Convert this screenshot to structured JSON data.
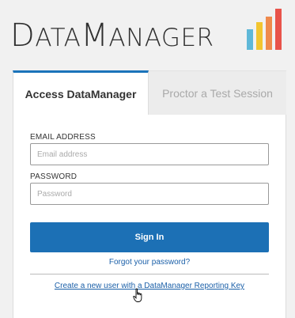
{
  "logo": {
    "prefix_d": "D",
    "ata": "ATA",
    "m": "M",
    "anager": "ANAGER"
  },
  "logo_colors": [
    "#5fb8d8",
    "#f2c530",
    "#ef8a4c",
    "#e8534a"
  ],
  "tabs": [
    {
      "label": "Access DataManager",
      "active": true
    },
    {
      "label": "Proctor a Test Session",
      "active": false
    }
  ],
  "form": {
    "email_label": "EMAIL ADDRESS",
    "email_placeholder": "Email address",
    "password_label": "PASSWORD",
    "password_placeholder": "Password",
    "sign_in": "Sign In",
    "forgot": "Forgot your password?",
    "create_user": "Create a new user with a DataManager Reporting Key"
  },
  "colors": {
    "primary": "#1c70b5",
    "link": "#1a5fa8"
  }
}
